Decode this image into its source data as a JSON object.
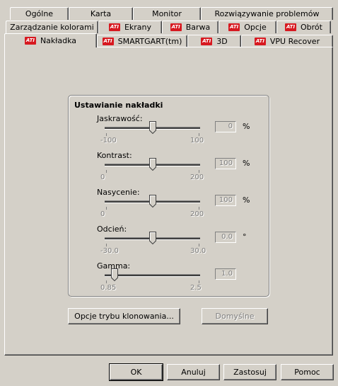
{
  "tabs_row1": [
    {
      "label": "Ogólne",
      "ati": false
    },
    {
      "label": "Karta",
      "ati": false
    },
    {
      "label": "Monitor",
      "ati": false
    },
    {
      "label": "Rozwiązywanie problemów",
      "ati": false
    }
  ],
  "tabs_row2": [
    {
      "label": "Zarządzanie kolorami",
      "ati": false
    },
    {
      "label": "Ekrany",
      "ati": true
    },
    {
      "label": "Barwa",
      "ati": true
    },
    {
      "label": "Opcje",
      "ati": true
    },
    {
      "label": "Obrót",
      "ati": true
    }
  ],
  "tabs_row3": [
    {
      "label": "Nakładka",
      "ati": true,
      "active": true
    },
    {
      "label": "SMARTGART(tm)",
      "ati": true
    },
    {
      "label": "3D",
      "ati": true
    },
    {
      "label": "VPU Recover",
      "ati": true
    }
  ],
  "ati_logo_text": "ATI",
  "group_title": "Ustawianie nakładki",
  "sliders": [
    {
      "label": "Jaskrawość:",
      "min": "-100",
      "max": "100",
      "value": "0",
      "unit": "%",
      "min_value": -100,
      "max_value": 100,
      "current": 0
    },
    {
      "label": "Kontrast:",
      "min": "0",
      "max": "200",
      "value": "100",
      "unit": "%",
      "min_value": 0,
      "max_value": 200,
      "current": 100
    },
    {
      "label": "Nasycenie:",
      "min": "0",
      "max": "200",
      "value": "100",
      "unit": "%",
      "min_value": 0,
      "max_value": 200,
      "current": 100
    },
    {
      "label": "Odcień:",
      "min": "-30.0",
      "max": "30.0",
      "value": "0.0",
      "unit": "°",
      "min_value": -30,
      "max_value": 30,
      "current": 0
    },
    {
      "label": "Gamma:",
      "min": "0.85",
      "max": "2.5",
      "value": "1.0",
      "unit": "",
      "min_value": 0.85,
      "max_value": 2.5,
      "current": 1.0
    }
  ],
  "clone_options_button": "Opcje trybu klonowania...",
  "defaults_button": "Domyślne",
  "footer": {
    "ok": "OK",
    "cancel": "Anuluj",
    "apply": "Zastosuj",
    "help": "Pomoc"
  }
}
